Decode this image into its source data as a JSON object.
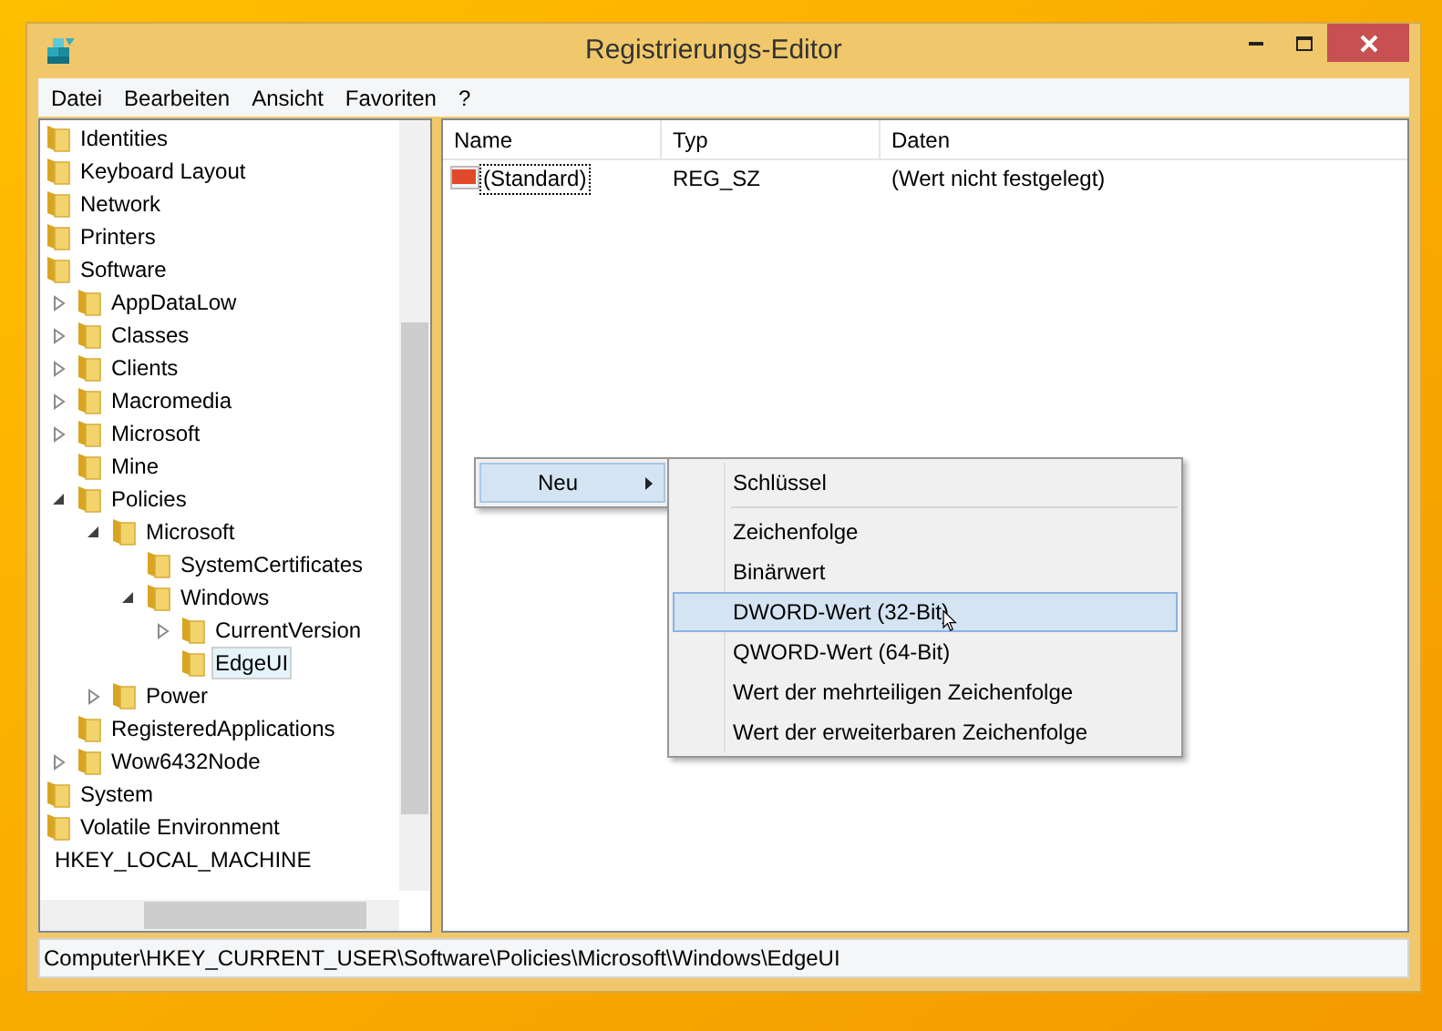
{
  "window": {
    "title": "Registrierungs-Editor"
  },
  "menu_bar": [
    "Datei",
    "Bearbeiten",
    "Ansicht",
    "Favoriten",
    "?"
  ],
  "tree": [
    {
      "label": "Identities",
      "kind": "folder",
      "has_expander": false,
      "selected": false
    },
    {
      "label": "Keyboard Layout",
      "kind": "folder",
      "has_expander": false,
      "selected": false
    },
    {
      "label": "Network",
      "kind": "folder",
      "has_expander": false,
      "selected": false
    },
    {
      "label": "Printers",
      "kind": "folder",
      "has_expander": false,
      "selected": false
    },
    {
      "label": "Software",
      "kind": "folder",
      "has_expander": false,
      "selected": false,
      "children": [
        {
          "label": "AppDataLow",
          "kind": "folder",
          "has_expander": true,
          "expanded": false,
          "selected": false
        },
        {
          "label": "Classes",
          "kind": "folder",
          "has_expander": true,
          "expanded": false,
          "selected": false
        },
        {
          "label": "Clients",
          "kind": "folder",
          "has_expander": true,
          "expanded": false,
          "selected": false
        },
        {
          "label": "Macromedia",
          "kind": "folder",
          "has_expander": true,
          "expanded": false,
          "selected": false
        },
        {
          "label": "Microsoft",
          "kind": "folder",
          "has_expander": true,
          "expanded": false,
          "selected": false
        },
        {
          "label": "Mine",
          "kind": "folder",
          "has_expander": false,
          "selected": false
        },
        {
          "label": "Policies",
          "kind": "folder",
          "has_expander": true,
          "expanded": true,
          "selected": false,
          "children": [
            {
              "label": "Microsoft",
              "kind": "folder",
              "has_expander": true,
              "expanded": true,
              "selected": false,
              "children": [
                {
                  "label": "SystemCertificates",
                  "kind": "folder",
                  "has_expander": false,
                  "selected": false
                },
                {
                  "label": "Windows",
                  "kind": "folder",
                  "has_expander": true,
                  "expanded": true,
                  "selected": false,
                  "children": [
                    {
                      "label": "CurrentVersion",
                      "kind": "folder",
                      "has_expander": true,
                      "expanded": false,
                      "selected": false
                    },
                    {
                      "label": "EdgeUI",
                      "kind": "folder",
                      "has_expander": false,
                      "selected": true
                    }
                  ]
                }
              ]
            },
            {
              "label": "Power",
              "kind": "folder",
              "has_expander": true,
              "expanded": false,
              "selected": false
            }
          ]
        },
        {
          "label": "RegisteredApplications",
          "kind": "folder",
          "has_expander": false,
          "selected": false
        },
        {
          "label": "Wow6432Node",
          "kind": "folder",
          "has_expander": true,
          "expanded": false,
          "selected": false
        }
      ]
    },
    {
      "label": "System",
      "kind": "folder",
      "has_expander": false,
      "selected": false
    },
    {
      "label": "Volatile Environment",
      "kind": "folder",
      "has_expander": false,
      "selected": false
    },
    {
      "label": "HKEY_LOCAL_MACHINE",
      "kind": "hive",
      "has_expander": false,
      "selected": false
    }
  ],
  "table": {
    "columns": [
      "Name",
      "Typ",
      "Daten"
    ],
    "rows": [
      {
        "name": "(Standard)",
        "type": "REG_SZ",
        "data": "(Wert nicht festgelegt)"
      }
    ]
  },
  "context_menu": {
    "items": [
      {
        "label": "Neu",
        "selected": true,
        "submenu": true
      }
    ]
  },
  "submenu": {
    "items": [
      {
        "label": "Schlüssel",
        "selected": false,
        "separator_after": true
      },
      {
        "label": "Zeichenfolge",
        "selected": false,
        "separator_after": false
      },
      {
        "label": "Binärwert",
        "selected": false,
        "separator_after": false
      },
      {
        "label": "DWORD-Wert (32-Bit)",
        "selected": true,
        "separator_after": false
      },
      {
        "label": "QWORD-Wert (64-Bit)",
        "selected": false,
        "separator_after": false
      },
      {
        "label": "Wert der mehrteiligen Zeichenfolge",
        "selected": false,
        "separator_after": false
      },
      {
        "label": "Wert der erweiterbaren Zeichenfolge",
        "selected": false,
        "separator_after": false
      }
    ]
  },
  "status_bar": "Computer\\HKEY_CURRENT_USER\\Software\\Policies\\Microsoft\\Windows\\EdgeUI"
}
